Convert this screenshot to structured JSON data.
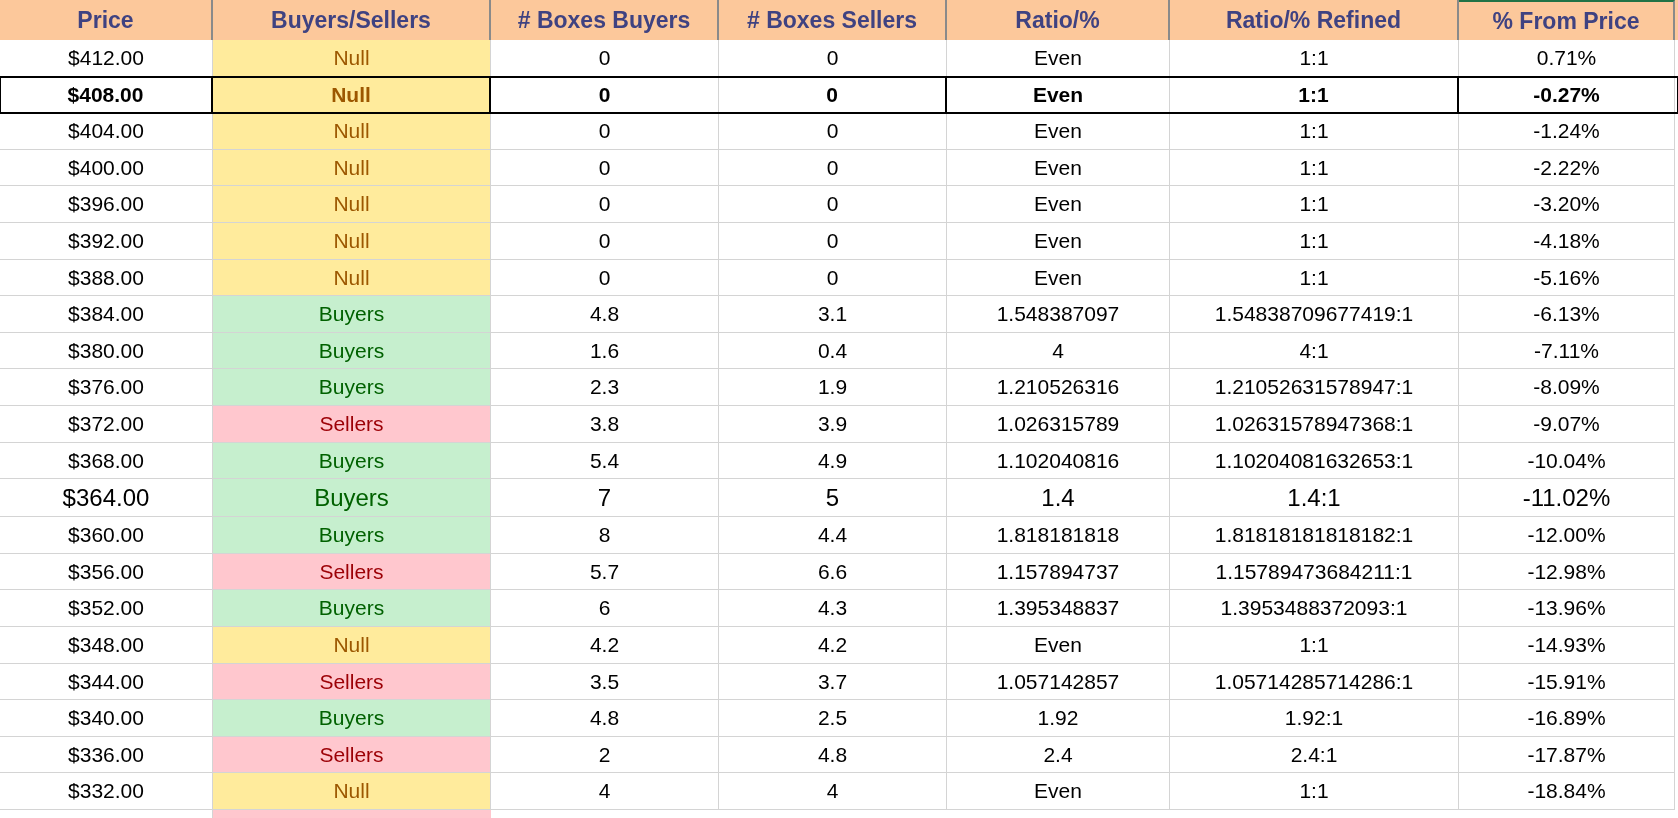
{
  "table": {
    "columns": [
      "Price",
      "Buyers/Sellers",
      "# Boxes Buyers",
      "# Boxes Sellers",
      "Ratio/%",
      "Ratio/% Refined",
      "% From Price"
    ],
    "rows": [
      {
        "kind": "normal",
        "color": "#ffeb9c",
        "cells": [
          "$412.00",
          "Null",
          "0",
          "0",
          "Even",
          "1:1",
          "0.71%"
        ]
      },
      {
        "kind": "current",
        "color": "#ffeb9c",
        "cells": [
          "$408.00",
          "Null",
          "0",
          "0",
          "Even",
          "1:1",
          "-0.27%"
        ]
      },
      {
        "kind": "normal",
        "color": "#ffeb9c",
        "cells": [
          "$404.00",
          "Null",
          "0",
          "0",
          "Even",
          "1:1",
          "-1.24%"
        ]
      },
      {
        "kind": "normal",
        "color": "#ffeb9c",
        "cells": [
          "$400.00",
          "Null",
          "0",
          "0",
          "Even",
          "1:1",
          "-2.22%"
        ]
      },
      {
        "kind": "normal",
        "color": "#ffeb9c",
        "cells": [
          "$396.00",
          "Null",
          "0",
          "0",
          "Even",
          "1:1",
          "-3.20%"
        ]
      },
      {
        "kind": "normal",
        "color": "#ffeb9c",
        "cells": [
          "$392.00",
          "Null",
          "0",
          "0",
          "Even",
          "1:1",
          "-4.18%"
        ]
      },
      {
        "kind": "normal",
        "color": "#ffeb9c",
        "cells": [
          "$388.00",
          "Null",
          "0",
          "0",
          "Even",
          "1:1",
          "-5.16%"
        ]
      },
      {
        "kind": "normal",
        "color": "#c6efce",
        "cells": [
          "$384.00",
          "Buyers",
          "4.8",
          "3.1",
          "1.548387097",
          "1.54838709677419:1",
          "-6.13%"
        ]
      },
      {
        "kind": "normal",
        "color": "#c6efce",
        "cells": [
          "$380.00",
          "Buyers",
          "1.6",
          "0.4",
          "4",
          "4:1",
          "-7.11%"
        ]
      },
      {
        "kind": "normal",
        "color": "#c6efce",
        "cells": [
          "$376.00",
          "Buyers",
          "2.3",
          "1.9",
          "1.210526316",
          "1.21052631578947:1",
          "-8.09%"
        ]
      },
      {
        "kind": "normal",
        "color": "#ffc7ce",
        "cells": [
          "$372.00",
          "Sellers",
          "3.8",
          "3.9",
          "1.026315789",
          "1.02631578947368:1",
          "-9.07%"
        ]
      },
      {
        "kind": "normal",
        "color": "#c6efce",
        "cells": [
          "$368.00",
          "Buyers",
          "5.4",
          "4.9",
          "1.102040816",
          "1.10204081632653:1",
          "-10.04%"
        ]
      },
      {
        "kind": "large",
        "color": "#c6efce",
        "cells": [
          "$364.00",
          "Buyers",
          "7",
          "5",
          "1.4",
          "1.4:1",
          "-11.02%"
        ]
      },
      {
        "kind": "normal",
        "color": "#c6efce",
        "cells": [
          "$360.00",
          "Buyers",
          "8",
          "4.4",
          "1.818181818",
          "1.81818181818182:1",
          "-12.00%"
        ]
      },
      {
        "kind": "normal",
        "color": "#ffc7ce",
        "cells": [
          "$356.00",
          "Sellers",
          "5.7",
          "6.6",
          "1.157894737",
          "1.15789473684211:1",
          "-12.98%"
        ]
      },
      {
        "kind": "normal",
        "color": "#c6efce",
        "cells": [
          "$352.00",
          "Buyers",
          "6",
          "4.3",
          "1.395348837",
          "1.3953488372093:1",
          "-13.96%"
        ]
      },
      {
        "kind": "normal",
        "color": "#ffeb9c",
        "cells": [
          "$348.00",
          "Null",
          "4.2",
          "4.2",
          "Even",
          "1:1",
          "-14.93%"
        ]
      },
      {
        "kind": "normal",
        "color": "#ffc7ce",
        "cells": [
          "$344.00",
          "Sellers",
          "3.5",
          "3.7",
          "1.057142857",
          "1.05714285714286:1",
          "-15.91%"
        ]
      },
      {
        "kind": "normal",
        "color": "#c6efce",
        "cells": [
          "$340.00",
          "Buyers",
          "4.8",
          "2.5",
          "1.92",
          "1.92:1",
          "-16.89%"
        ]
      },
      {
        "kind": "normal",
        "color": "#ffc7ce",
        "cells": [
          "$336.00",
          "Sellers",
          "2",
          "4.8",
          "2.4",
          "2.4:1",
          "-17.87%"
        ]
      },
      {
        "kind": "normal",
        "color": "#ffeb9c",
        "cells": [
          "$332.00",
          "Null",
          "4",
          "4",
          "Even",
          "1:1",
          "-18.84%"
        ]
      }
    ],
    "clipped_row": {
      "color": "#ffc7ce"
    }
  }
}
